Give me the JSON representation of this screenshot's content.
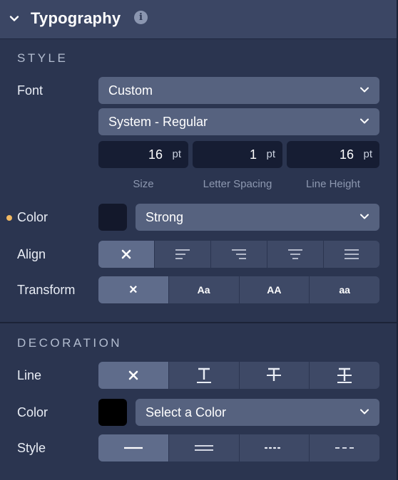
{
  "header": {
    "title": "Typography",
    "info_glyph": "i"
  },
  "style_section": {
    "title": "STYLE",
    "font_label": "Font",
    "font_family": "Custom",
    "font_weight": "System - Regular",
    "size": {
      "value": "16",
      "unit": "pt",
      "label": "Size"
    },
    "letter_spacing": {
      "value": "1",
      "unit": "pt",
      "label": "Letter Spacing"
    },
    "line_height": {
      "value": "16",
      "unit": "pt",
      "label": "Line Height"
    },
    "color_label": "Color",
    "color_value": "Strong",
    "color_swatch": "#13182b",
    "modified_indicator_color": "#f0b862",
    "align_label": "Align",
    "align_options": [
      "none",
      "left",
      "right",
      "center",
      "justify"
    ],
    "align_selected": "none",
    "transform_label": "Transform",
    "transform_options": [
      "×",
      "Aa",
      "AA",
      "aa"
    ],
    "transform_selected": "none"
  },
  "decoration_section": {
    "title": "DECORATION",
    "line_label": "Line",
    "line_options": [
      "none",
      "underline",
      "strikethrough",
      "overline-strike"
    ],
    "line_selected": "none",
    "color_label": "Color",
    "color_placeholder": "Select a Color",
    "color_swatch": "#000000",
    "style_label": "Style",
    "style_options": [
      "solid",
      "double",
      "dotted",
      "dashed"
    ],
    "style_selected": "solid"
  }
}
